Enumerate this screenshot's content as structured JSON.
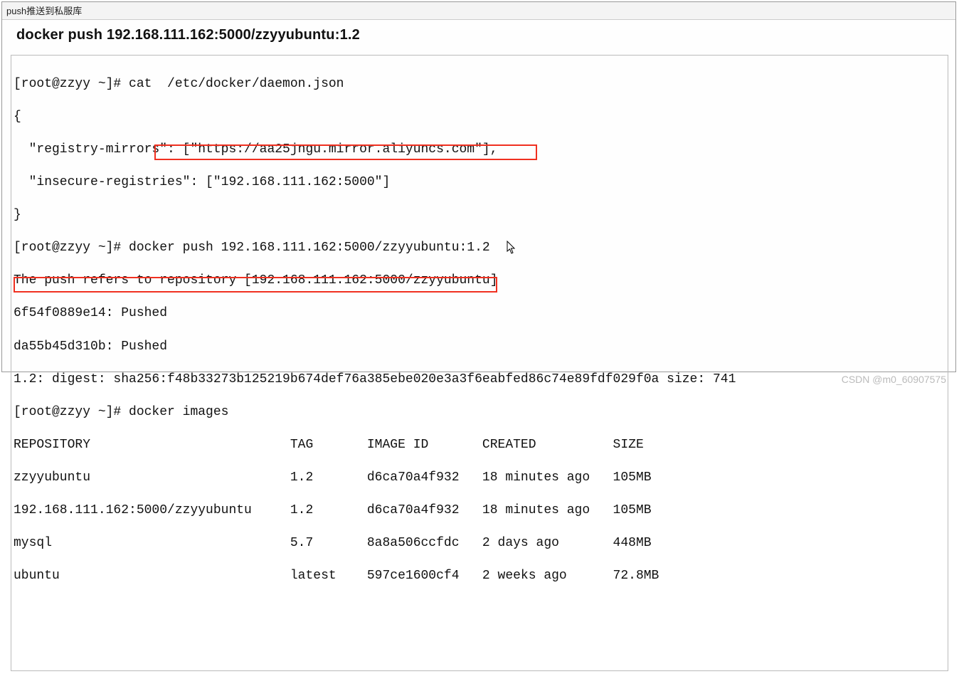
{
  "panel": {
    "header": "push推送到私服库"
  },
  "title": "docker push 192.168.111.162:5000/zzyyubuntu:1.2",
  "term": {
    "l01": "[root@zzyy ~]# cat  /etc/docker/daemon.json",
    "l02": "{",
    "l03": "  \"registry-mirrors\": [\"https://aa25jngu.mirror.aliyuncs.com\"],",
    "l04": "  \"insecure-registries\": [\"192.168.111.162:5000\"]",
    "l05": "}",
    "l06": "[root@zzyy ~]# docker push 192.168.111.162:5000/zzyyubuntu:1.2",
    "l07": "The push refers to repository [192.168.111.162:5000/zzyyubuntu]",
    "l08": "6f54f0889e14: Pushed",
    "l09": "da55b45d310b: Pushed",
    "l10": "1.2: digest: sha256:f48b33273b125219b674def76a385ebe020e3a3f6eabfed86c74e89fdf029f0a size: 741",
    "l11": "[root@zzyy ~]# docker images",
    "h1": "REPOSITORY                          TAG       IMAGE ID       CREATED          SIZE",
    "r1": "zzyyubuntu                          1.2       d6ca70a4f932   18 minutes ago   105MB",
    "r2": "192.168.111.162:5000/zzyyubuntu     1.2       d6ca70a4f932   18 minutes ago   105MB",
    "r3": "mysql                               5.7       8a8a506ccfdc   2 days ago       448MB",
    "r4": "ubuntu                              latest    597ce1600cf4   2 weeks ago      72.8MB"
  },
  "watermark": "CSDN @m0_60907575"
}
